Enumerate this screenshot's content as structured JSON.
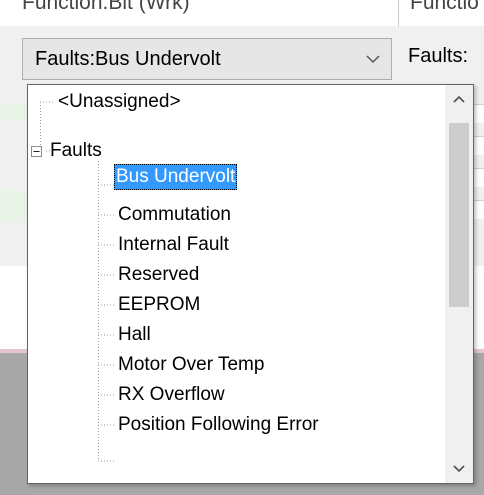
{
  "header": {
    "left_text": "Function.Bit (Wrk)",
    "right_text": "Functio"
  },
  "combo": {
    "value": "Faults:Bus Undervolt",
    "arrow_icon": "chevron-down-icon"
  },
  "right_column": {
    "combo_text": "Faults:"
  },
  "dropdown": {
    "items": [
      {
        "label": "<Unassigned>",
        "level": 0,
        "selected": false
      },
      {
        "label": "Faults",
        "level": 0,
        "expanded": true,
        "selected": false
      },
      {
        "label": "Bus Undervolt",
        "level": 1,
        "selected": true
      },
      {
        "label": "Commutation",
        "level": 1,
        "selected": false
      },
      {
        "label": "Internal Fault",
        "level": 1,
        "selected": false
      },
      {
        "label": "Reserved",
        "level": 1,
        "selected": false
      },
      {
        "label": "EEPROM",
        "level": 1,
        "selected": false
      },
      {
        "label": "Hall",
        "level": 1,
        "selected": false
      },
      {
        "label": "Motor Over Temp",
        "level": 1,
        "selected": false
      },
      {
        "label": "RX Overflow",
        "level": 1,
        "selected": false
      },
      {
        "label": "Position Following Error",
        "level": 1,
        "selected": false
      }
    ],
    "scrollbar": {
      "up_icon": "chevron-up-icon",
      "down_icon": "chevron-down-icon",
      "thumb_fraction_start": 0,
      "thumb_fraction_size": 0.47
    }
  },
  "colors": {
    "selection": "#3399ff",
    "selection_text": "#ffffff",
    "tree_lines": "#a0a0a0"
  }
}
